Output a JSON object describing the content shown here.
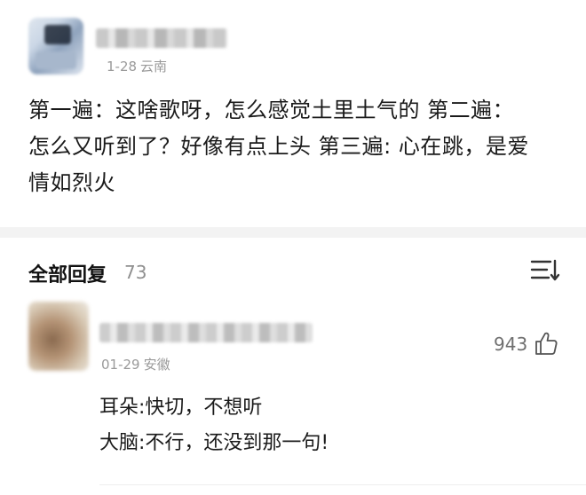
{
  "top_comment": {
    "date": "1-28",
    "location": "云南",
    "body_lines": [
      "第一遍：这啥歌呀，怎么感觉土里土气的   第二遍：",
      "怎么又听到了？好像有点上头  第三遍: 心在跳，是爱",
      "情如烈火"
    ]
  },
  "replies": {
    "title": "全部回复",
    "count": "73",
    "sort_icon": "sort-icon"
  },
  "reply": {
    "date": "01-29",
    "location": "安徽",
    "like_count": "943",
    "like_icon": "thumbs-up-icon",
    "body_lines": [
      "耳朵:快切，不想听",
      "大脑:不行，还没到那一句!"
    ]
  }
}
